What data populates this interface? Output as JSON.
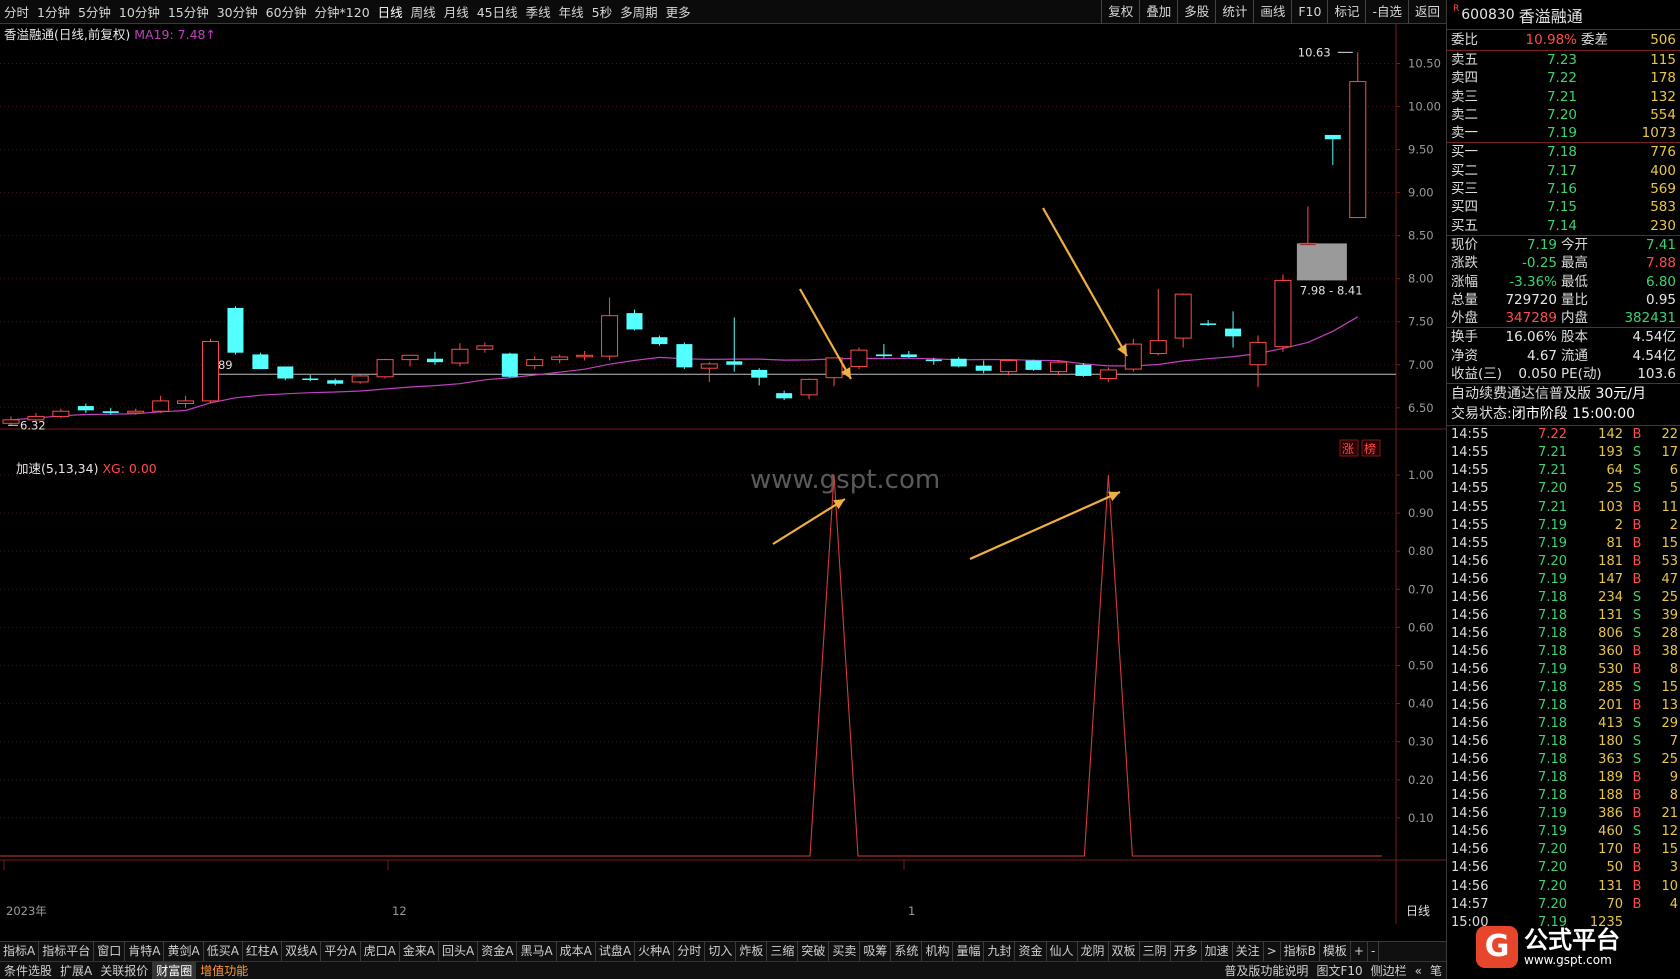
{
  "toolbar": {
    "periods": [
      "分时",
      "1分钟",
      "5分钟",
      "10分钟",
      "15分钟",
      "30分钟",
      "60分钟",
      "分钟*120",
      "日线",
      "周线",
      "月线",
      "45日线",
      "季线",
      "年线",
      "5秒",
      "多周期",
      "更多"
    ],
    "active_period": "日线",
    "tools": [
      "复权",
      "叠加",
      "多股",
      "统计",
      "画线",
      "F10",
      "标记",
      "-自选",
      "返回"
    ]
  },
  "chart": {
    "title": "香溢融通(日线,前复权)",
    "ma_label": "MA19: 7.48",
    "ma_arrow": "↑",
    "ma_color": "#c040c0",
    "up_color": "#ff4b4b",
    "down_color": "#54ffff",
    "high_label": "10.63",
    "low_label": "6.32",
    "ref_label": "6.89",
    "gap_label": "7.98 - 8.41",
    "badge_zhang": "涨",
    "badge_bang": "榜",
    "y_ticks": [
      "10.50",
      "10.00",
      "9.50",
      "9.00",
      "8.50",
      "8.00",
      "7.50",
      "7.00",
      "6.50"
    ],
    "x_labels": [
      "2023年",
      "12",
      "1"
    ],
    "period_label": "日线",
    "watermark": "www.gspt.com"
  },
  "indicator": {
    "title": "加速(5,13,34)",
    "value_label": "XG: 0.00",
    "y_ticks": [
      "1.00",
      "0.90",
      "0.80",
      "0.70",
      "0.60",
      "0.50",
      "0.40",
      "0.30",
      "0.20",
      "0.10"
    ]
  },
  "quote": {
    "mark": "R",
    "code": "600830",
    "name": "香溢融通",
    "weibi": {
      "label": "委比",
      "value": "10.98%",
      "label2": "委差",
      "value2": "506"
    },
    "asks": [
      {
        "label": "卖五",
        "price": "7.23",
        "vol": "115"
      },
      {
        "label": "卖四",
        "price": "7.22",
        "vol": "178"
      },
      {
        "label": "卖三",
        "price": "7.21",
        "vol": "132"
      },
      {
        "label": "卖二",
        "price": "7.20",
        "vol": "554"
      },
      {
        "label": "卖一",
        "price": "7.19",
        "vol": "1073"
      }
    ],
    "bids": [
      {
        "label": "买一",
        "price": "7.18",
        "vol": "776"
      },
      {
        "label": "买二",
        "price": "7.17",
        "vol": "400"
      },
      {
        "label": "买三",
        "price": "7.16",
        "vol": "569"
      },
      {
        "label": "买四",
        "price": "7.15",
        "vol": "583"
      },
      {
        "label": "买五",
        "price": "7.14",
        "vol": "230"
      }
    ],
    "stats1": [
      {
        "l1": "现价",
        "v1": "7.19",
        "c1": "green",
        "l2": "今开",
        "v2": "7.41",
        "c2": "green"
      },
      {
        "l1": "涨跌",
        "v1": "-0.25",
        "c1": "green",
        "l2": "最高",
        "v2": "7.88",
        "c2": "red"
      },
      {
        "l1": "涨幅",
        "v1": "-3.36%",
        "c1": "green",
        "l2": "最低",
        "v2": "6.80",
        "c2": "green"
      },
      {
        "l1": "总量",
        "v1": "729720",
        "c1": "white",
        "l2": "量比",
        "v2": "0.95",
        "c2": "white"
      },
      {
        "l1": "外盘",
        "v1": "347289",
        "c1": "red",
        "l2": "内盘",
        "v2": "382431",
        "c2": "green"
      }
    ],
    "stats2": [
      {
        "l1": "换手",
        "v1": "16.06%",
        "c1": "white",
        "l2": "股本",
        "v2": "4.54亿",
        "c2": "white"
      },
      {
        "l1": "净资",
        "v1": "4.67",
        "c1": "white",
        "l2": "流通",
        "v2": "4.54亿",
        "c2": "white"
      },
      {
        "l1": "收益(三)",
        "v1": "0.050",
        "c1": "white",
        "l2": "PE(动)",
        "v2": "103.6",
        "c2": "white"
      }
    ],
    "banner": "自动续费通达信普及版",
    "banner_price": "30元/月",
    "trade_state_label": "交易状态:",
    "trade_state": "闭市阶段",
    "trade_time": "15:00:00",
    "ticks": [
      {
        "t": "14:55",
        "p": "7.22",
        "pc": "red",
        "v": "142",
        "bs": "B",
        "n": "22"
      },
      {
        "t": "14:55",
        "p": "7.21",
        "pc": "green",
        "v": "193",
        "bs": "S",
        "n": "17"
      },
      {
        "t": "14:55",
        "p": "7.21",
        "pc": "green",
        "v": "64",
        "bs": "S",
        "n": "6"
      },
      {
        "t": "14:55",
        "p": "7.20",
        "pc": "green",
        "v": "25",
        "bs": "S",
        "n": "5"
      },
      {
        "t": "14:55",
        "p": "7.21",
        "pc": "green",
        "v": "103",
        "bs": "B",
        "n": "11"
      },
      {
        "t": "14:55",
        "p": "7.19",
        "pc": "green",
        "v": "2",
        "bs": "B",
        "n": "2"
      },
      {
        "t": "14:55",
        "p": "7.19",
        "pc": "green",
        "v": "81",
        "bs": "B",
        "n": "15"
      },
      {
        "t": "14:56",
        "p": "7.20",
        "pc": "green",
        "v": "181",
        "bs": "B",
        "n": "53"
      },
      {
        "t": "14:56",
        "p": "7.19",
        "pc": "green",
        "v": "147",
        "bs": "B",
        "n": "47"
      },
      {
        "t": "14:56",
        "p": "7.18",
        "pc": "green",
        "v": "234",
        "bs": "S",
        "n": "25"
      },
      {
        "t": "14:56",
        "p": "7.18",
        "pc": "green",
        "v": "131",
        "bs": "S",
        "n": "39"
      },
      {
        "t": "14:56",
        "p": "7.18",
        "pc": "green",
        "v": "806",
        "vc": "purple",
        "bs": "S",
        "n": "28"
      },
      {
        "t": "14:56",
        "p": "7.18",
        "pc": "green",
        "v": "360",
        "bs": "B",
        "n": "38"
      },
      {
        "t": "14:56",
        "p": "7.19",
        "pc": "green",
        "v": "530",
        "vc": "purple",
        "bs": "B",
        "n": "8"
      },
      {
        "t": "14:56",
        "p": "7.18",
        "pc": "green",
        "v": "285",
        "bs": "S",
        "n": "15"
      },
      {
        "t": "14:56",
        "p": "7.18",
        "pc": "green",
        "v": "201",
        "bs": "B",
        "n": "13"
      },
      {
        "t": "14:56",
        "p": "7.18",
        "pc": "green",
        "v": "413",
        "bs": "S",
        "n": "29"
      },
      {
        "t": "14:56",
        "p": "7.18",
        "pc": "green",
        "v": "180",
        "bs": "S",
        "n": "7"
      },
      {
        "t": "14:56",
        "p": "7.18",
        "pc": "green",
        "v": "363",
        "bs": "S",
        "n": "25"
      },
      {
        "t": "14:56",
        "p": "7.18",
        "pc": "green",
        "v": "189",
        "bs": "B",
        "n": "9"
      },
      {
        "t": "14:56",
        "p": "7.18",
        "pc": "green",
        "v": "188",
        "bs": "B",
        "n": "8"
      },
      {
        "t": "14:56",
        "p": "7.19",
        "pc": "green",
        "v": "386",
        "bs": "B",
        "n": "21"
      },
      {
        "t": "14:56",
        "p": "7.19",
        "pc": "green",
        "v": "460",
        "bs": "S",
        "n": "12"
      },
      {
        "t": "14:56",
        "p": "7.20",
        "pc": "green",
        "v": "170",
        "bs": "B",
        "n": "15"
      },
      {
        "t": "14:56",
        "p": "7.20",
        "pc": "green",
        "v": "50",
        "bs": "B",
        "n": "3"
      },
      {
        "t": "14:56",
        "p": "7.20",
        "pc": "green",
        "v": "131",
        "bs": "B",
        "n": "10"
      },
      {
        "t": "14:57",
        "p": "7.20",
        "pc": "green",
        "v": "70",
        "bs": "B",
        "n": "4"
      },
      {
        "t": "15:00",
        "p": "7.19",
        "pc": "green",
        "v": "1235",
        "bs": "",
        "n": ""
      }
    ]
  },
  "tabs": [
    "指标A",
    "指标平台",
    "窗口",
    "肯特A",
    "黄剑A",
    "低买A",
    "红柱A",
    "双线A",
    "平分A",
    "虎口A",
    "金来A",
    "回头A",
    "资金A",
    "黑马A",
    "成本A",
    "试盘A",
    "火种A",
    "分时",
    "切入",
    "炸板",
    "三缩",
    "突破",
    "买卖",
    "吸筹",
    "系统",
    "机构",
    "量幅",
    "九封",
    "资金",
    "仙人",
    "龙阴",
    "双板",
    "三阴",
    "开多",
    "加速",
    "关注",
    ">",
    "指标B",
    "模板",
    "+",
    "-"
  ],
  "statusbar": {
    "items": [
      "条件选股",
      "扩展A",
      "关联报价",
      "财富圈"
    ],
    "highlight": "增值功能",
    "right_items": [
      "普及版功能说明",
      "图文F10",
      "侧边栏",
      "«",
      "笔"
    ]
  },
  "logo": {
    "badge": "G",
    "name": "公式平台",
    "url": "www.gspt.com"
  },
  "chart_data": [
    {
      "type": "candlestick",
      "title": "香溢融通(日线,前复权)",
      "ylim": [
        6.3,
        10.75
      ],
      "x_labels": [
        "2023年",
        "12",
        "1"
      ],
      "ohlc": [
        [
          6.32,
          6.4,
          6.3,
          6.36
        ],
        [
          6.36,
          6.44,
          6.34,
          6.4
        ],
        [
          6.4,
          6.49,
          6.38,
          6.46
        ],
        [
          6.52,
          6.55,
          6.44,
          6.47
        ],
        [
          6.46,
          6.5,
          6.42,
          6.44
        ],
        [
          6.44,
          6.49,
          6.42,
          6.46
        ],
        [
          6.46,
          6.64,
          6.44,
          6.58
        ],
        [
          6.55,
          6.64,
          6.5,
          6.58
        ],
        [
          6.58,
          7.3,
          6.55,
          7.27
        ],
        [
          7.66,
          7.68,
          7.12,
          7.14
        ],
        [
          7.12,
          7.14,
          6.95,
          6.95
        ],
        [
          6.98,
          6.98,
          6.82,
          6.84
        ],
        [
          6.84,
          6.88,
          6.81,
          6.83
        ],
        [
          6.82,
          6.84,
          6.76,
          6.78
        ],
        [
          6.8,
          6.88,
          6.78,
          6.87
        ],
        [
          6.86,
          7.07,
          6.84,
          7.06
        ],
        [
          7.06,
          7.1,
          6.98,
          7.11
        ],
        [
          7.07,
          7.15,
          7.0,
          7.03
        ],
        [
          7.02,
          7.25,
          6.98,
          7.18
        ],
        [
          7.18,
          7.26,
          7.14,
          7.22
        ],
        [
          7.13,
          7.14,
          6.85,
          6.86
        ],
        [
          6.99,
          7.1,
          6.95,
          7.06
        ],
        [
          7.06,
          7.12,
          7.02,
          7.09
        ],
        [
          7.1,
          7.16,
          7.05,
          7.11
        ],
        [
          7.1,
          7.78,
          7.05,
          7.57
        ],
        [
          7.6,
          7.64,
          7.4,
          7.41
        ],
        [
          7.32,
          7.34,
          7.22,
          7.24
        ],
        [
          7.24,
          7.26,
          6.95,
          6.97
        ],
        [
          6.96,
          7.03,
          6.8,
          7.01
        ],
        [
          7.04,
          7.55,
          6.92,
          7.0
        ],
        [
          6.94,
          6.96,
          6.76,
          6.85
        ],
        [
          6.67,
          6.7,
          6.59,
          6.61
        ],
        [
          6.65,
          6.84,
          6.6,
          6.83
        ],
        [
          6.85,
          6.98,
          6.75,
          7.08
        ],
        [
          6.98,
          7.2,
          6.95,
          7.17
        ],
        [
          7.12,
          7.24,
          7.08,
          7.1
        ],
        [
          7.12,
          7.16,
          7.08,
          7.09
        ],
        [
          7.06,
          7.08,
          7.0,
          7.05
        ],
        [
          7.07,
          7.09,
          6.97,
          6.98
        ],
        [
          6.99,
          7.05,
          6.9,
          6.93
        ],
        [
          6.92,
          7.06,
          6.88,
          7.05
        ],
        [
          7.05,
          7.06,
          6.93,
          6.94
        ],
        [
          6.92,
          7.05,
          6.88,
          7.03
        ],
        [
          7.0,
          7.02,
          6.86,
          6.87
        ],
        [
          6.84,
          6.97,
          6.8,
          6.94
        ],
        [
          6.95,
          7.3,
          6.92,
          7.24
        ],
        [
          7.13,
          7.88,
          7.11,
          7.28
        ],
        [
          7.31,
          7.83,
          7.2,
          7.82
        ],
        [
          7.48,
          7.52,
          7.45,
          7.47
        ],
        [
          7.42,
          7.62,
          7.2,
          7.33
        ],
        [
          7.0,
          7.34,
          6.74,
          7.26
        ],
        [
          7.21,
          8.05,
          7.15,
          7.98
        ],
        [
          8.41,
          8.84,
          8.41,
          8.41
        ],
        [
          9.67,
          9.67,
          9.32,
          9.62
        ],
        [
          8.71,
          10.63,
          8.71,
          10.29
        ]
      ],
      "ma": {
        "name": "MA19",
        "last": 7.48
      },
      "ref_line": 6.89,
      "gap": [
        7.98,
        8.41
      ],
      "annotations": [
        "10.63",
        "6.32",
        "6.89",
        "7.98 - 8.41"
      ]
    },
    {
      "type": "line",
      "title": "加速(5,13,34)",
      "ylim": [
        0,
        1.0
      ],
      "series": [
        {
          "name": "XG",
          "signal_bars": [
            33,
            44
          ],
          "peak": 1.0,
          "base": 0.0
        }
      ]
    }
  ]
}
